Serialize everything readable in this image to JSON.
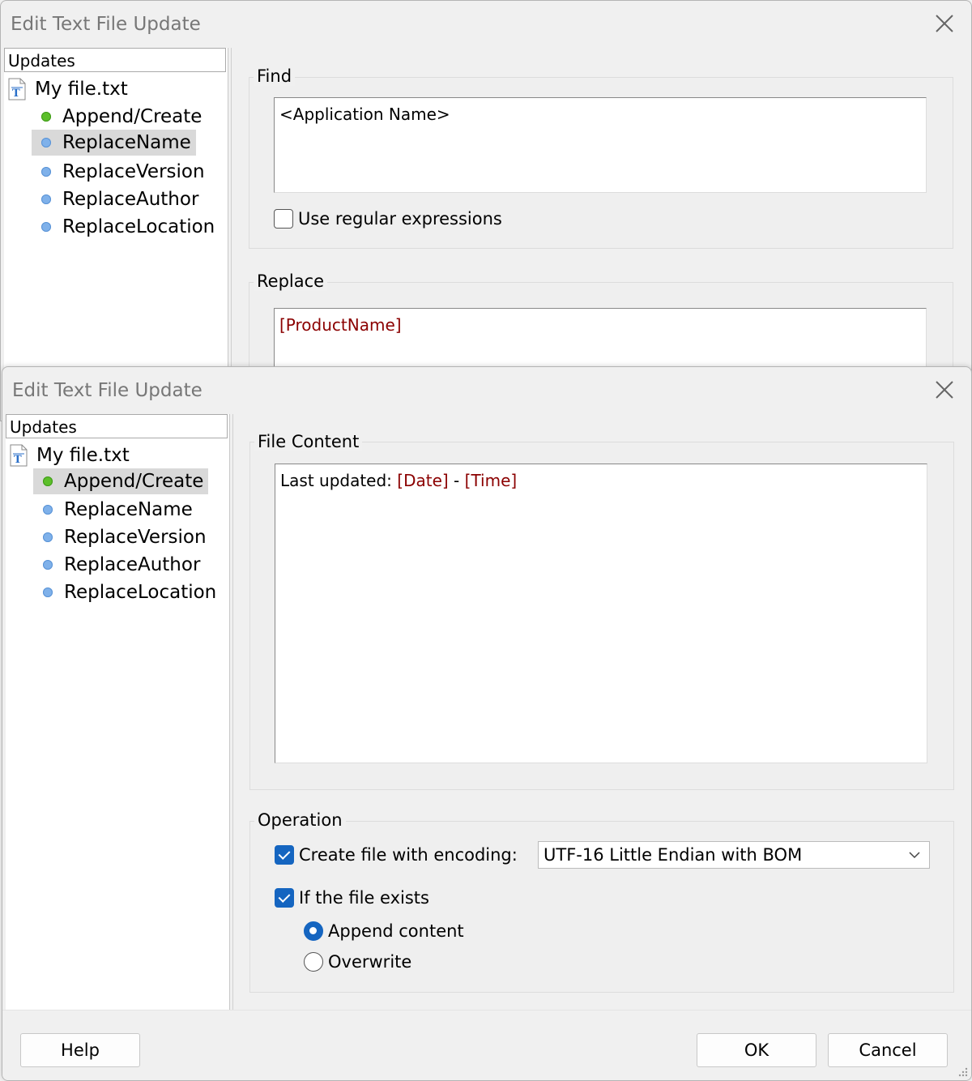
{
  "back_dialog": {
    "title": "Edit Text File Update",
    "updates_header": "Updates",
    "file_name": "My file.txt",
    "items": [
      {
        "label": "Append/Create",
        "dot": "green"
      },
      {
        "label": "ReplaceName",
        "dot": "blue",
        "selected": true
      },
      {
        "label": "ReplaceVersion",
        "dot": "blue"
      },
      {
        "label": "ReplaceAuthor",
        "dot": "blue"
      },
      {
        "label": "ReplaceLocation",
        "dot": "blue"
      }
    ],
    "find_label": "Find",
    "find_value": "<Application Name>",
    "regex_label": "Use regular expressions",
    "regex_checked": false,
    "replace_label": "Replace",
    "replace_value": "[ProductName]"
  },
  "front_dialog": {
    "title": "Edit Text File Update",
    "updates_header": "Updates",
    "file_name": "My file.txt",
    "items": [
      {
        "label": "Append/Create",
        "dot": "green",
        "selected": true
      },
      {
        "label": "ReplaceName",
        "dot": "blue"
      },
      {
        "label": "ReplaceVersion",
        "dot": "blue"
      },
      {
        "label": "ReplaceAuthor",
        "dot": "blue"
      },
      {
        "label": "ReplaceLocation",
        "dot": "blue"
      }
    ],
    "file_content_label": "File Content",
    "file_content": {
      "prefix": "Last updated: ",
      "var1": "[Date]",
      "sep": " - ",
      "var2": "[Time]"
    },
    "operation_label": "Operation",
    "create_label": "Create file with encoding:",
    "create_checked": true,
    "encoding_value": "UTF-16 Little Endian with BOM",
    "exists_label": "If the file exists",
    "exists_checked": true,
    "append_label": "Append content",
    "overwrite_label": "Overwrite",
    "selected_mode": "append",
    "help_label": "Help",
    "ok_label": "OK",
    "cancel_label": "Cancel"
  },
  "icons": {
    "close": "close-icon",
    "file": "text-file-icon",
    "dropdown": "chevron-down-icon",
    "resize": "resize-grip-icon"
  },
  "colors": {
    "accent": "#1565c0",
    "variable_text": "#8b0000",
    "selection": "#d9d9d9",
    "dot_green": "#5cbf2a",
    "dot_blue": "#7fb1ea"
  }
}
